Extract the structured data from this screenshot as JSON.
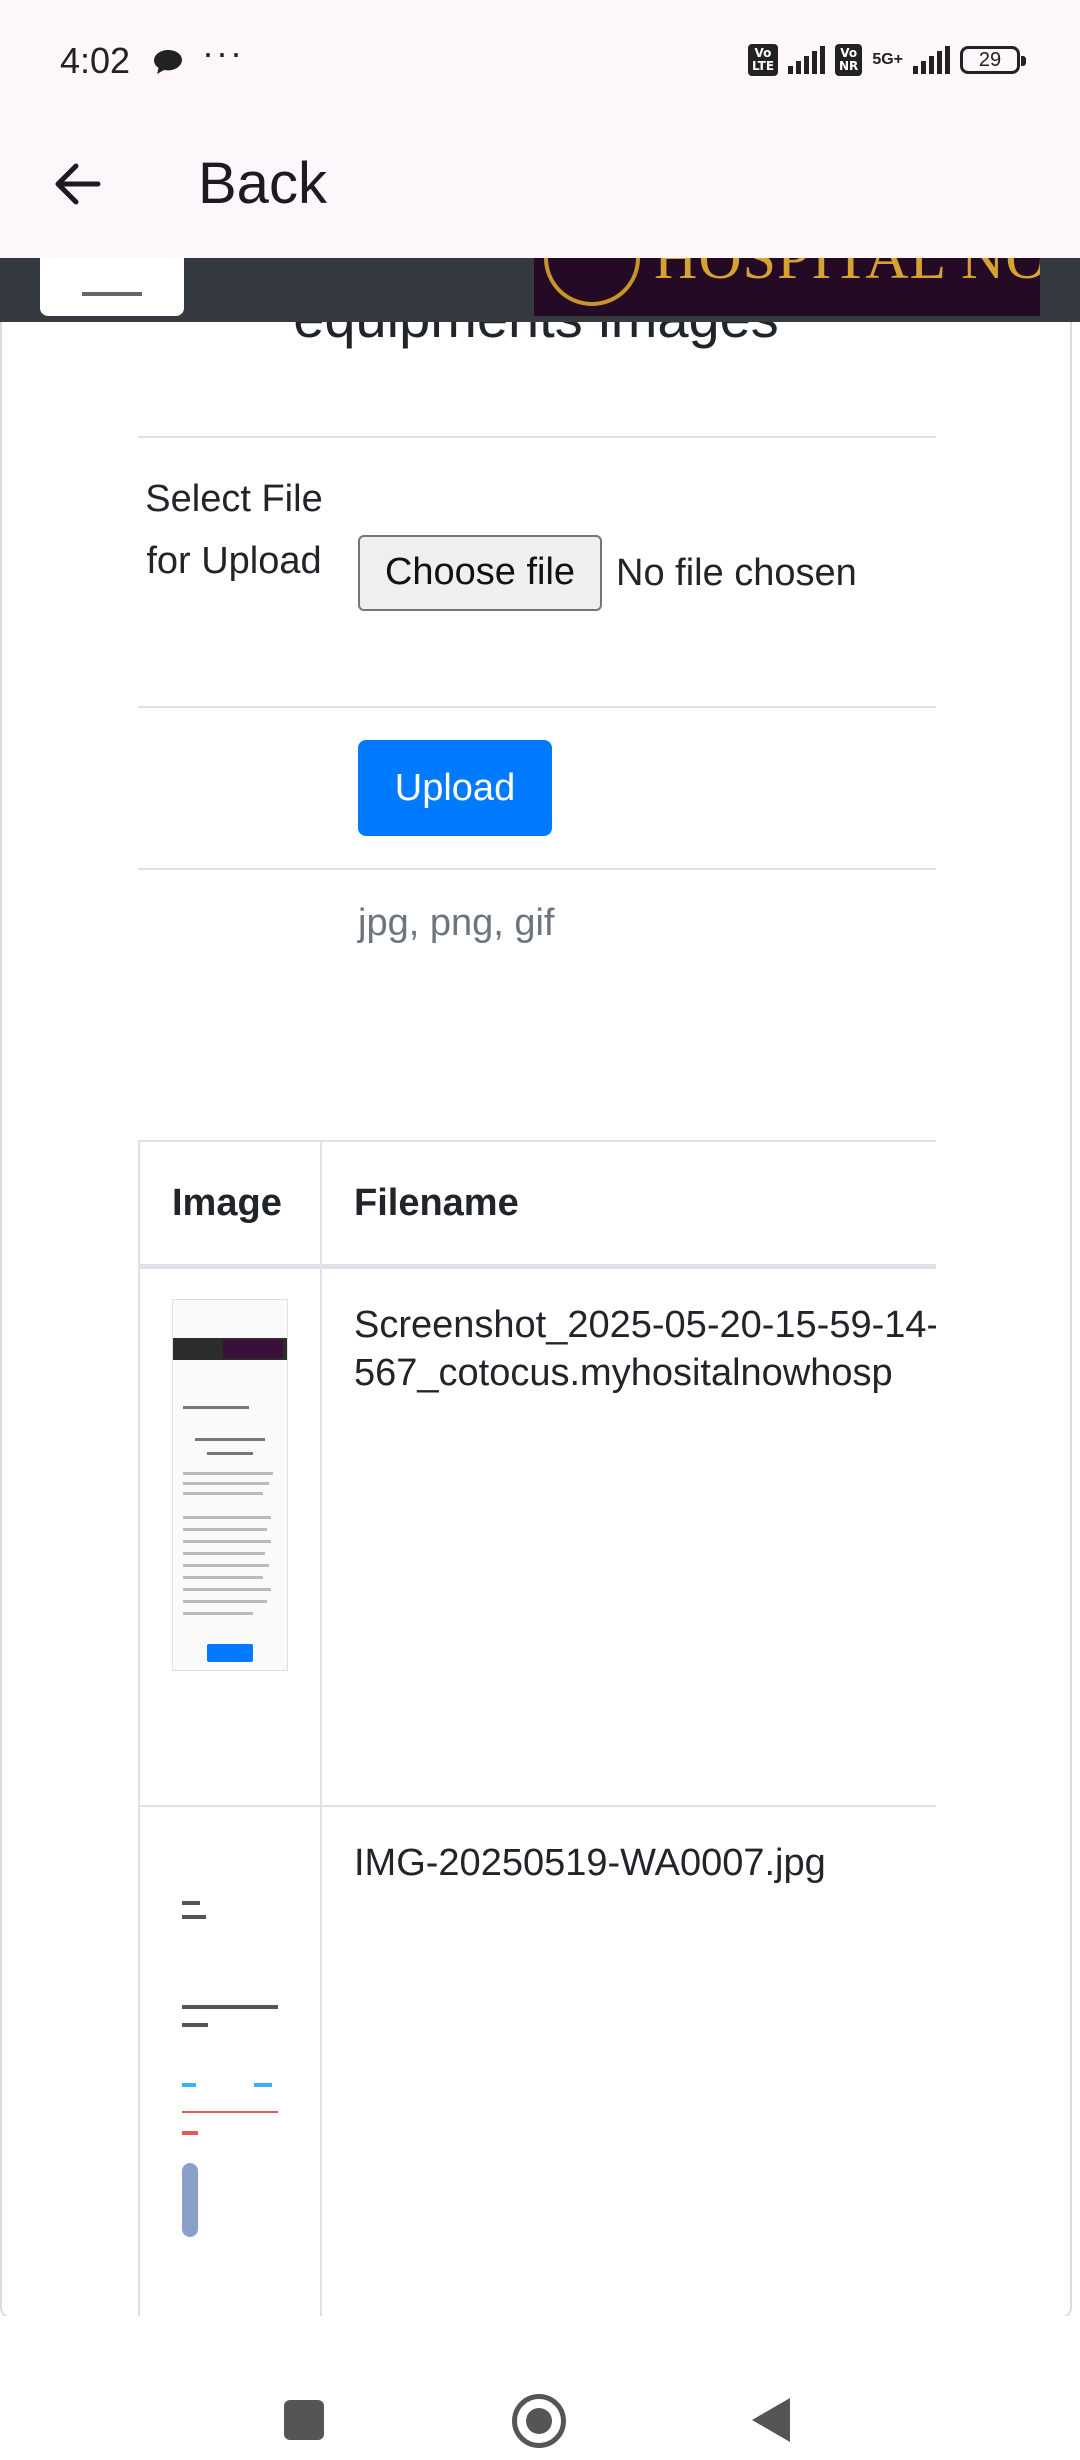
{
  "status_bar": {
    "time": "4:02",
    "battery": "29",
    "network_5g": "5G+",
    "volte_label": "Vo LTE",
    "vonr_label": "Vo NR"
  },
  "app_bar": {
    "back_label": "Back"
  },
  "site_header": {
    "logo_text": "MP HOSPITAL NOW"
  },
  "card": {
    "title": "equipments images",
    "select_label": "Select File for Upload",
    "choose_file_label": "Choose file",
    "file_status": "No file chosen",
    "upload_label": "Upload",
    "allowed_types": "jpg, png, gif"
  },
  "table": {
    "headers": {
      "image": "Image",
      "filename": "Filename"
    },
    "rows": [
      {
        "filename_line1": "Screenshot_2025-05-20-15-59-14-",
        "filename_line2": "567_cotocus.myhositalnowhosp"
      },
      {
        "filename_line1": "IMG-20250519-WA0007.jpg"
      }
    ]
  },
  "thumb1": {
    "back": "Back",
    "logo": "MP HOSPITAL NOW",
    "submit": "Submit Your Story",
    "premium": "Become a Premium Hospital",
    "btn": "Make Payment"
  },
  "colors": {
    "primary": "#007bff",
    "header_dark": "#343a40",
    "logo_bg": "#240a25",
    "logo_gold": "#d6a232",
    "app_bar_bg": "#fdf6fb"
  }
}
